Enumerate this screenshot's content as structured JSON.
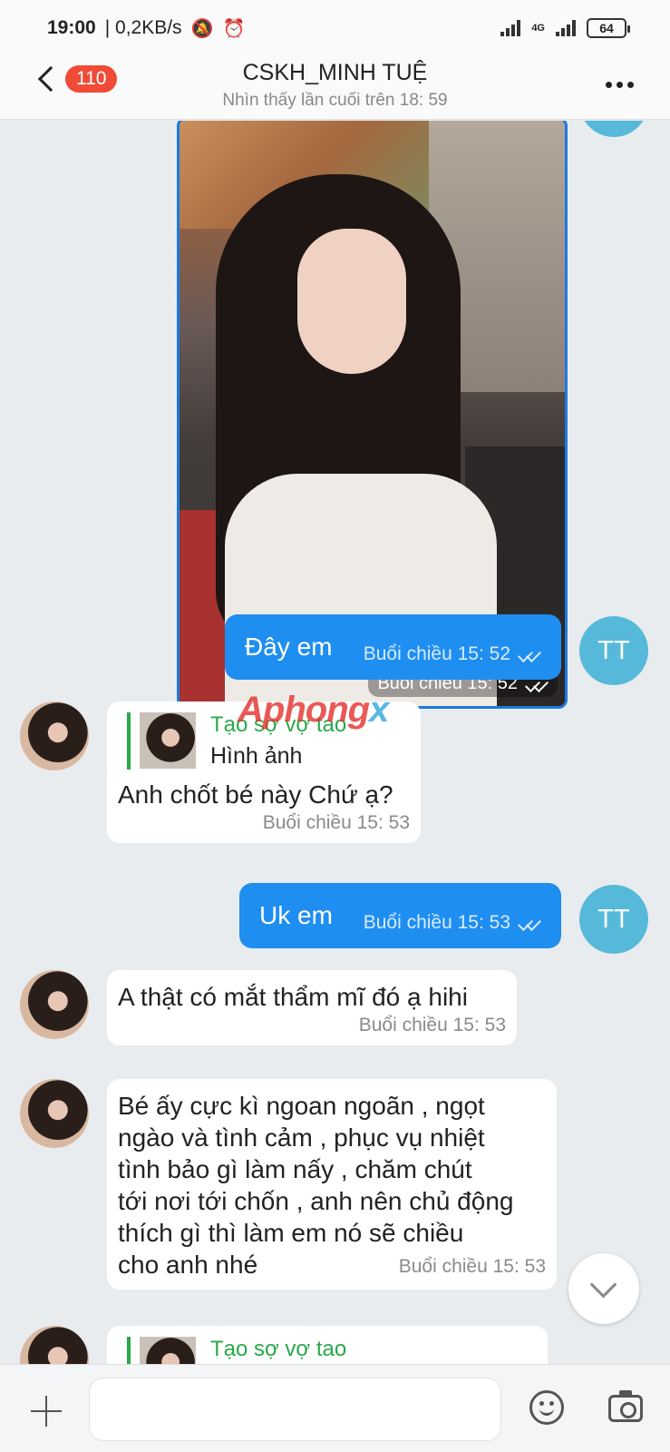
{
  "status_bar": {
    "time": "19:00",
    "speed": "| 0,2KB/s",
    "network": "4G",
    "battery": "64"
  },
  "header": {
    "unread_count": "110",
    "title": "CSKH_MINH TUỆ",
    "subtitle": "Nhìn thấy lần cuối trên 18: 59",
    "icons": [
      "back-icon",
      "more-icon"
    ]
  },
  "messages": {
    "photo": {
      "time": "Buổi chiều  15: 52"
    },
    "m1": {
      "text": "Đây em",
      "time": "Buổi chiều  15: 52",
      "avatar": "TT"
    },
    "m2": {
      "quote_name": "Tạo sợ vợ tao",
      "quote_type": "Hình ảnh",
      "text": "Anh chốt bé này Chứ ạ?",
      "time": "Buổi chiều  15: 53"
    },
    "m3": {
      "text": "Uk em",
      "time": "Buổi chiều  15: 53",
      "avatar": "TT"
    },
    "m4": {
      "text": "A thật có mắt thẩm mĩ đó ạ hihi",
      "time": "Buổi chiều  15: 53"
    },
    "m5": {
      "lines": [
        "Bé ấy cực kì ngoan ngoãn , ngọt",
        "ngào và tình cảm , phục vụ nhiệt",
        "tình bảo gì làm nấy , chăm chút",
        "tới nơi tới chốn , anh nên chủ động",
        "thích gì thì làm em nó sẽ chiều",
        "cho anh nhé"
      ],
      "time": "Buổi chiều  15: 53"
    },
    "m6": {
      "quote_name": "Tạo sợ vợ tao"
    }
  },
  "watermark": {
    "part1": "Aphong",
    "part2": "x"
  },
  "composer": {
    "placeholder": ""
  },
  "colors": {
    "outgoing": "#1f8ef1",
    "avatar_tt": "#57b9d9",
    "quote": "#2aa84a",
    "badge": "#ef4b36"
  }
}
